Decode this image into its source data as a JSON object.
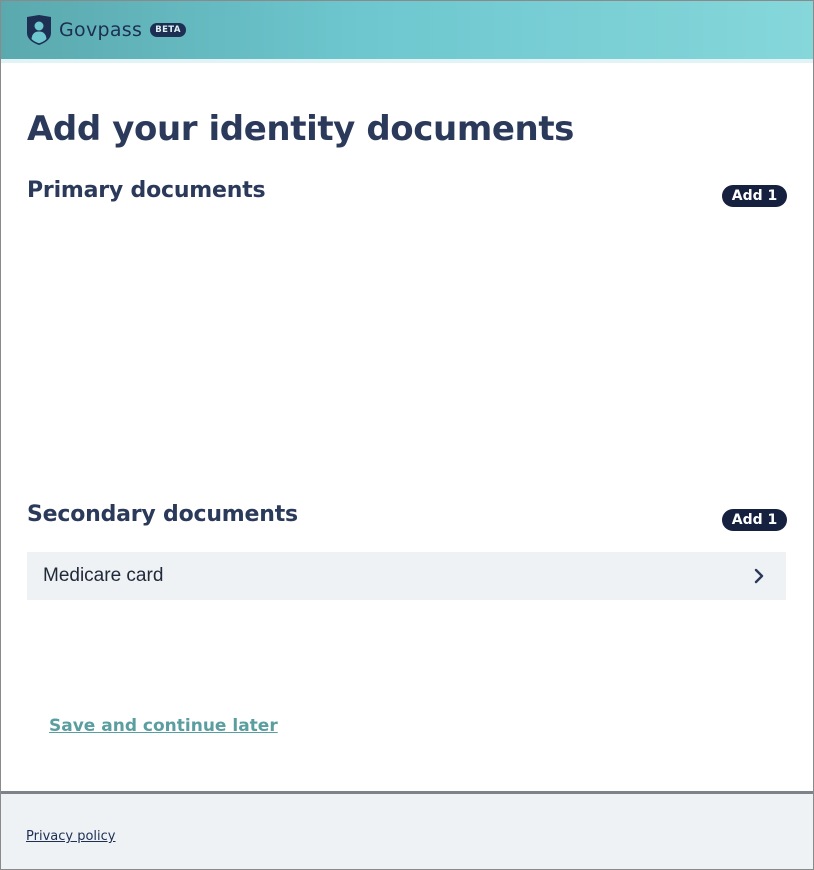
{
  "header": {
    "brand_name": "Govpass",
    "beta_label": "BETA",
    "logo_icon": "shield-person-icon"
  },
  "main": {
    "title": "Add your identity documents",
    "primary": {
      "title": "Primary documents",
      "add_label": "Add 1",
      "documents": []
    },
    "secondary": {
      "title": "Secondary documents",
      "add_label": "Add 1",
      "documents": [
        {
          "label": "Medicare card",
          "icon": "chevron-right-icon"
        }
      ]
    },
    "save_link": "Save and continue later"
  },
  "footer": {
    "privacy_link": "Privacy policy"
  },
  "colors": {
    "header_start": "#5aa9ae",
    "header_end": "#85d7da",
    "navy": "#16213f",
    "title": "#2b3a5a",
    "link_teal": "#5b9ea0",
    "row_bg": "#eef2f5"
  }
}
